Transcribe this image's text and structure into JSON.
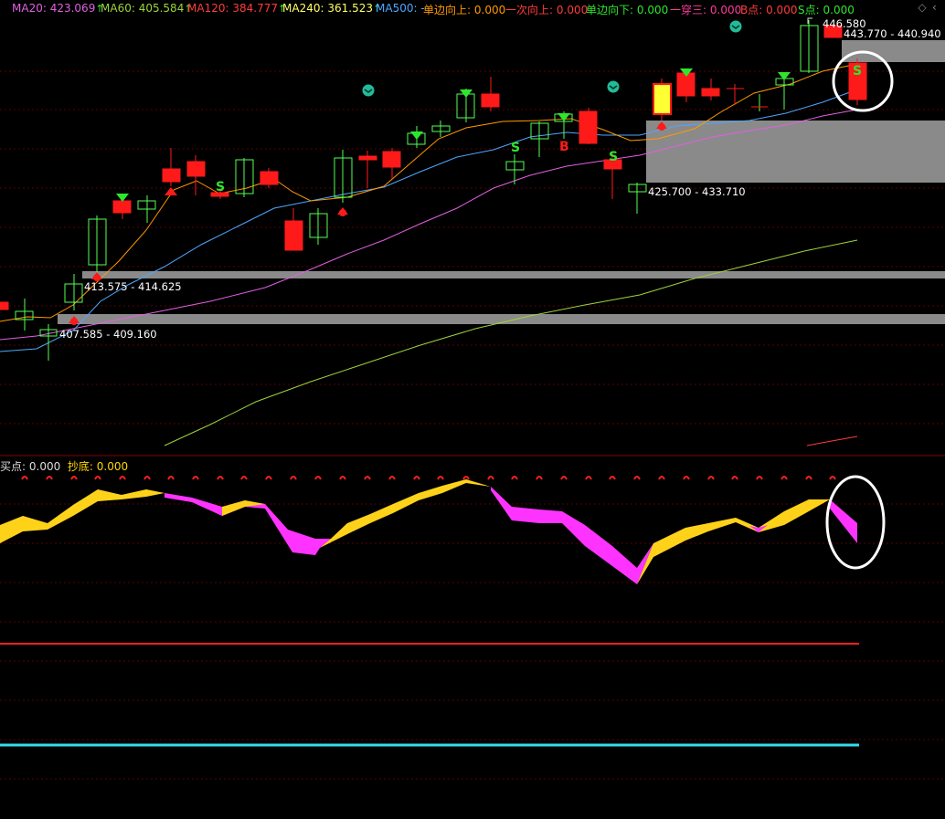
{
  "header": {
    "indicators": [
      {
        "label": "MA20:",
        "value": "423.069",
        "color": "#e060e0"
      },
      {
        "label": "MA60:",
        "value": "405.584",
        "color": "#9ed33b"
      },
      {
        "label": "MA120:",
        "value": "384.777",
        "color": "#ff3b3b"
      },
      {
        "label": "MA240:",
        "value": "361.523",
        "color": "#ffff66"
      },
      {
        "label": "MA500:",
        "value": "-",
        "color": "#4ea6ff"
      },
      {
        "label": "单边向上:",
        "value": "0.000",
        "color": "#ff9900"
      },
      {
        "label": "一次向上:",
        "value": "0.000",
        "color": "#ff3b3b"
      },
      {
        "label": "单边向下:",
        "value": "0.000",
        "color": "#2ee62e"
      },
      {
        "label": "一穿三:",
        "value": "0.000",
        "color": "#ff3b9d"
      },
      {
        "label": "B点:",
        "value": "0.000",
        "color": "#ff3b3b"
      },
      {
        "label": "S点:",
        "value": "0.000",
        "color": "#2ee62e"
      }
    ],
    "arrow": "↑",
    "arrow_color": "#2ee62e"
  },
  "price_labels": {
    "high": "446.580",
    "zone_top": "443.770 - 440.940",
    "zone_mid": "425.700 - 433.710",
    "zone_a": "413.575 - 414.625",
    "zone_b": "407.585 - 409.160"
  },
  "markers": {
    "buy": "B",
    "sell": "S"
  },
  "sub_header": {
    "buy_label": "买点:",
    "buy_value": "0.000",
    "buy_color": "#dddddd",
    "bottom_label": "抄底:",
    "bottom_value": "0.000",
    "bottom_color": "#ffd700"
  },
  "colors": {
    "up_candle": "#54ff54",
    "down_candle": "#ff1a1a",
    "zone_fill": "#8a8a8a",
    "osc_up": "#ffd21a",
    "osc_down": "#ff33ff",
    "ref_red": "#ff2020",
    "ref_cyan": "#33ddee"
  }
}
